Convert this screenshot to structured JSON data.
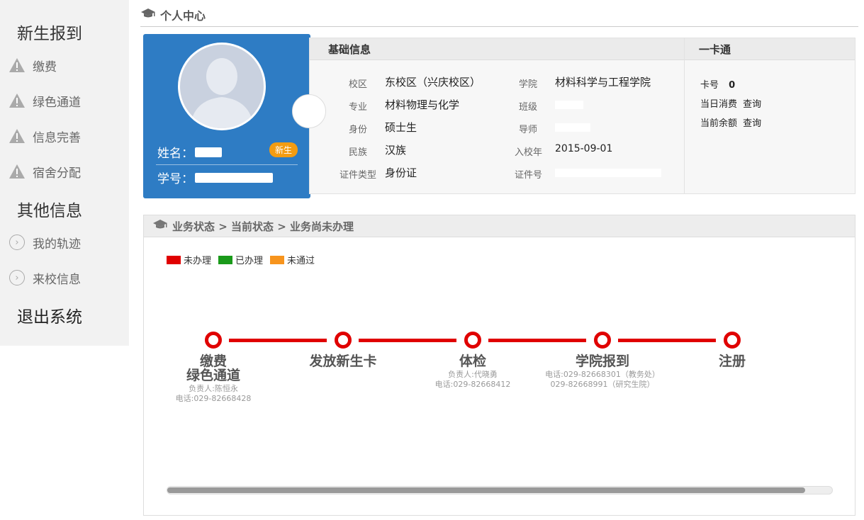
{
  "header": {
    "title": "个人中心"
  },
  "sidebar": {
    "group1_title": "新生报到",
    "items1": [
      {
        "label": "缴费"
      },
      {
        "label": "绿色通道"
      },
      {
        "label": "信息完善"
      },
      {
        "label": "宿舍分配"
      }
    ],
    "group2_title": "其他信息",
    "items2": [
      {
        "label": "我的轨迹"
      },
      {
        "label": "来校信息"
      }
    ],
    "logout": "退出系统"
  },
  "profile": {
    "name_label": "姓名：",
    "id_label": "学号：",
    "badge": "新生"
  },
  "basic_info": {
    "title": "基础信息",
    "campus_label": "校区",
    "campus": "东校区（兴庆校区）",
    "college_label": "学院",
    "college": "材料科学与工程学院",
    "major_label": "专业",
    "major": "材料物理与化学",
    "class_label": "班级",
    "identity_label": "身份",
    "identity": "硕士生",
    "advisor_label": "导师",
    "ethnicity_label": "民族",
    "ethnicity": "汉族",
    "enroll_label": "入校年",
    "enroll": "2015-09-01",
    "idtype_label": "证件类型",
    "idtype": "身份证",
    "idno_label": "证件号"
  },
  "card": {
    "title": "一卡通",
    "card_no_label": "卡号",
    "card_no": "0",
    "daily_label": "当日消费",
    "daily_link": "查询",
    "balance_label": "当前余额",
    "balance_link": "查询"
  },
  "status": {
    "title": "业务状态 > 当前状态 > 业务尚未办理",
    "legend": [
      {
        "label": "未办理",
        "color": "#e00000"
      },
      {
        "label": "已办理",
        "color": "#1a9a1a"
      },
      {
        "label": "未通过",
        "color": "#f7941d"
      }
    ],
    "stages": [
      {
        "title1": "缴费",
        "title2": "绿色通道",
        "sub1": "负责人:陈恒永",
        "sub2": "电话:029-82668428"
      },
      {
        "title1": "发放新生卡"
      },
      {
        "title1": "体检",
        "sub1": "负责人:代晓勇",
        "sub2": "电话:029-82668412"
      },
      {
        "title1": "学院报到",
        "sub1": "电话:029-82668301（教务处）",
        "sub2": "029-82668991（研究生院）"
      },
      {
        "title1": "注册"
      }
    ]
  }
}
